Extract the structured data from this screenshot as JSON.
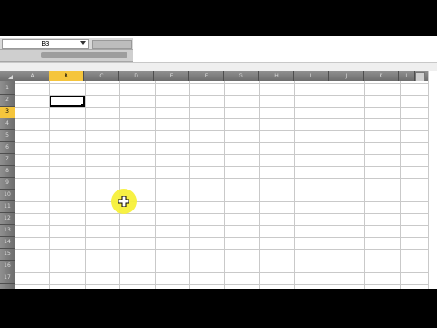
{
  "name_box": {
    "value": "B3"
  },
  "columns": [
    "A",
    "B",
    "C",
    "D",
    "E",
    "F",
    "G",
    "H",
    "I",
    "J",
    "K",
    "L"
  ],
  "active_column": "B",
  "rows": [
    "1",
    "2",
    "3",
    "4",
    "5",
    "6",
    "7",
    "8",
    "9",
    "10",
    "11",
    "12",
    "13",
    "14",
    "15",
    "16",
    "17"
  ],
  "active_row": "3",
  "colors": {
    "highlight": "#f5c53c",
    "cursor_halo": "#f7f03a",
    "header_bg": "#7d7d7d"
  }
}
